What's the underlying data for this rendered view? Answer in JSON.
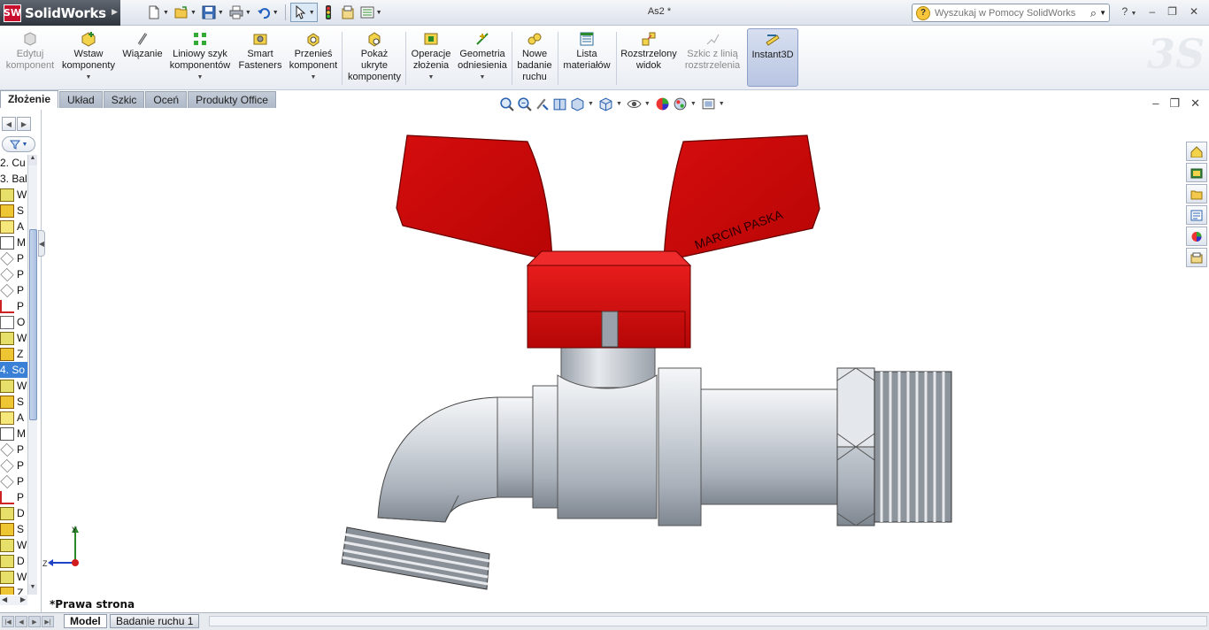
{
  "app": {
    "name": "SolidWorks",
    "logo_text": "SW",
    "document_title": "As2 *"
  },
  "quick_access": {
    "icons": [
      "new-document-icon",
      "open-folder-icon",
      "save-icon",
      "print-icon",
      "undo-icon",
      "select-arrow-icon",
      "traffic-light-icon",
      "file-properties-icon",
      "options-icon"
    ]
  },
  "search": {
    "placeholder": "Wyszukaj w Pomocy SolidWorks",
    "value": ""
  },
  "help": {
    "label": "?"
  },
  "ribbon": {
    "buttons": [
      {
        "label": "Edytuj\nkomponent",
        "icon": "edit-component-icon",
        "enabled": false,
        "dropdown": false
      },
      {
        "label": "Wstaw\nkomponenty",
        "icon": "insert-components-icon",
        "enabled": true,
        "dropdown": true
      },
      {
        "label": "Wiązanie",
        "icon": "mate-icon",
        "enabled": true,
        "dropdown": false
      },
      {
        "label": "Liniowy szyk\nkomponentów",
        "icon": "linear-pattern-icon",
        "enabled": true,
        "dropdown": true
      },
      {
        "label": "Smart\nFasteners",
        "icon": "smart-fasteners-icon",
        "enabled": true,
        "dropdown": false
      },
      {
        "label": "Przenieś\nkomponent",
        "icon": "move-component-icon",
        "enabled": true,
        "dropdown": true
      },
      {
        "label": "Pokaż\nukryte\nkomponenty",
        "icon": "show-hidden-icon",
        "enabled": true,
        "dropdown": false
      },
      {
        "label": "Operacje\nzłożenia",
        "icon": "assembly-features-icon",
        "enabled": true,
        "dropdown": true
      },
      {
        "label": "Geometria\nodniesienia",
        "icon": "reference-geometry-icon",
        "enabled": true,
        "dropdown": true
      },
      {
        "label": "Nowe\nbadanie\nruchu",
        "icon": "new-motion-study-icon",
        "enabled": true,
        "dropdown": false
      },
      {
        "label": "Lista\nmateriałów",
        "icon": "bill-of-materials-icon",
        "enabled": true,
        "dropdown": false
      },
      {
        "label": "Rozstrzelony\nwidok",
        "icon": "exploded-view-icon",
        "enabled": true,
        "dropdown": false
      },
      {
        "label": "Szkic z linią\nrozstrzelenia",
        "icon": "explode-line-sketch-icon",
        "enabled": false,
        "dropdown": false
      },
      {
        "label": "Instant3D",
        "icon": "instant3d-icon",
        "enabled": true,
        "dropdown": false,
        "active": true
      }
    ]
  },
  "command_tabs": [
    {
      "label": "Złożenie",
      "active": true
    },
    {
      "label": "Układ",
      "active": false
    },
    {
      "label": "Szkic",
      "active": false
    },
    {
      "label": "Oceń",
      "active": false
    },
    {
      "label": "Produkty Office",
      "active": false
    }
  ],
  "feature_tree": {
    "rows": [
      {
        "text": "2. Cu",
        "icon": "none"
      },
      {
        "text": "3. Bal",
        "icon": "none"
      },
      {
        "text": "W",
        "icon": "asm"
      },
      {
        "text": "S",
        "icon": "part"
      },
      {
        "text": "A",
        "icon": "grp"
      },
      {
        "text": "M",
        "icon": "mate"
      },
      {
        "text": "P",
        "icon": "plane"
      },
      {
        "text": "P",
        "icon": "plane"
      },
      {
        "text": "P",
        "icon": "plane"
      },
      {
        "text": "P",
        "icon": "pt"
      },
      {
        "text": "O",
        "icon": "spr"
      },
      {
        "text": "W",
        "icon": "asm"
      },
      {
        "text": "Z",
        "icon": "part"
      },
      {
        "text": "4. So",
        "icon": "none",
        "selected": true
      },
      {
        "text": "W",
        "icon": "asm"
      },
      {
        "text": "S",
        "icon": "part"
      },
      {
        "text": "A",
        "icon": "grp"
      },
      {
        "text": "M",
        "icon": "mate"
      },
      {
        "text": "P",
        "icon": "plane"
      },
      {
        "text": "P",
        "icon": "plane"
      },
      {
        "text": "P",
        "icon": "plane"
      },
      {
        "text": "P",
        "icon": "pt"
      },
      {
        "text": "D",
        "icon": "asm"
      },
      {
        "text": "S",
        "icon": "part"
      },
      {
        "text": "W",
        "icon": "asm"
      },
      {
        "text": "D",
        "icon": "asm"
      },
      {
        "text": "W",
        "icon": "asm"
      },
      {
        "text": "Z",
        "icon": "part"
      }
    ]
  },
  "graphics": {
    "engraving": "MARCIN PASKA",
    "view_orientation": "*Prawa strona",
    "triad": {
      "y": "Y",
      "z": "Z"
    },
    "colors": {
      "handle": "#cc0a0a",
      "metal": "#c8cdd4",
      "background": "#ffffff"
    }
  },
  "view_toolbar": {
    "icons": [
      "zoom-to-fit-icon",
      "zoom-area-icon",
      "previous-view-icon",
      "section-view-icon",
      "view-orientation-icon",
      "display-style-icon",
      "hide-show-items-icon",
      "edit-appearance-icon",
      "apply-scene-icon",
      "view-settings-icon"
    ]
  },
  "task_pane": {
    "icons": [
      "home-resources-icon",
      "design-library-icon",
      "file-explorer-icon",
      "view-palette-icon",
      "appearances-icon",
      "custom-properties-icon"
    ]
  },
  "bottom_tabs": [
    {
      "label": "Model",
      "active": true
    },
    {
      "label": "Badanie ruchu 1",
      "active": false
    }
  ]
}
